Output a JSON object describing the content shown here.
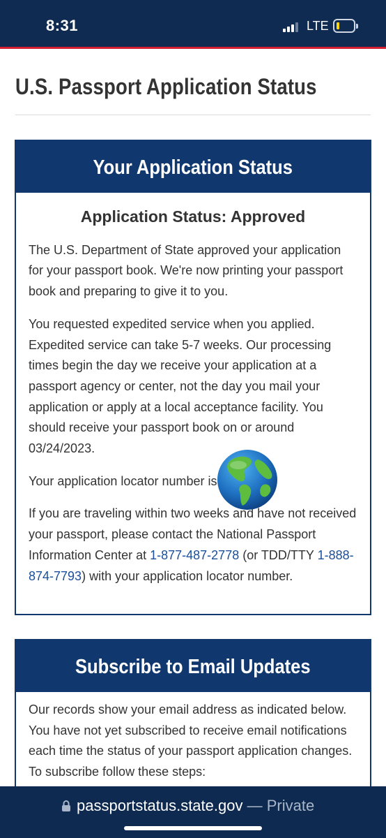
{
  "status_bar": {
    "time": "8:31",
    "network": "LTE",
    "signal_icon": "cellular-signal-icon",
    "battery_icon": "battery-low-icon",
    "battery_level": 0.15
  },
  "page": {
    "title": "U.S. Passport Application Status"
  },
  "status_panel": {
    "header": "Your Application Status",
    "status_heading": "Application Status: Approved",
    "para1": "The U.S. Department of State approved your application for your passport book. We're now printing your passport book and preparing to give it to you.",
    "para2": "You requested expedited service when you applied. Expedited service can take 5-7 weeks. Our processing times begin the day we receive your application at a passport agency or center, not the day you mail your application or apply at a local acceptance facility. You should receive your passport book on or around 03/24/2023.",
    "locator_text": "Your application locator number is",
    "locator_end": ".",
    "globe_icon": "globe-emoji-icon",
    "contact_text_1": "If you are traveling within two weeks and have not received your passport, please contact the National Passport Information Center at",
    "phone_1": "1-877-487-2778",
    "contact_text_2": "(or TDD/TTY",
    "phone_2": "1-888-874-7793",
    "contact_text_3": ") with your application locator number."
  },
  "email_panel": {
    "header": "Subscribe to Email Updates",
    "para1": "Our records show your email address as indicated below. You have not yet subscribed to receive email notifications each time the status of your passport application changes. To subscribe follow these steps:"
  },
  "browser": {
    "lock_icon": "lock-icon",
    "domain": "passportstatus.state.gov",
    "separator": "—",
    "mode": "Private"
  },
  "colors": {
    "navy": "#10386e",
    "status_bar": "#0f2b52",
    "accent_red": "#d21f32",
    "link": "#1a4f9c"
  }
}
